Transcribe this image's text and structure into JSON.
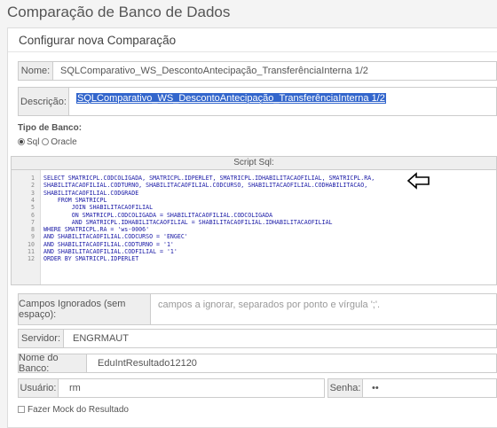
{
  "page_title": "Comparação de Banco de Dados",
  "panel_title": "Configurar nova Comparação",
  "nome": {
    "label": "Nome:",
    "value": "SQLComparativo_WS_DescontoAntecipação_TransferênciaInterna 1/2"
  },
  "descricao": {
    "label": "Descrição:",
    "value": "SQLComparativo_WS_DescontoAntecipação_TransferênciaInterna 1/2"
  },
  "tipo_banco": {
    "label": "Tipo de Banco:",
    "options": [
      {
        "label": "Sql",
        "selected": true
      },
      {
        "label": "Oracle",
        "selected": false
      }
    ]
  },
  "script": {
    "header": "Script Sql:",
    "lines": [
      {
        "n": "1",
        "text": "SELECT SMATRICPL.CODCOLIGADA, SMATRICPL.IDPERLET, SMATRICPL.IDHABILITACAOFILIAL, SMATRICPL.RA,"
      },
      {
        "n": "2",
        "text": "SHABILITACAOFILIAL.CODTURNO, SHABILITACAOFILIAL.CODCURSO, SHABILITACAOFILIAL.CODHABILITACAO,"
      },
      {
        "n": "3",
        "text": "SHABILITACAOFILIAL.CODGRADE"
      },
      {
        "n": "4",
        "text": "    FROM SMATRICPL"
      },
      {
        "n": "5",
        "text": "        JOIN SHABILITACAOFILIAL"
      },
      {
        "n": "6",
        "text": "        ON SMATRICPL.CODCOLIGADA = SHABILITACAOFILIAL.CODCOLIGADA"
      },
      {
        "n": "7",
        "text": "        AND SMATRICPL.IDHABILITACAOFILIAL = SHABILITACAOFILIAL.IDHABILITACAOFILIAL"
      },
      {
        "n": "8",
        "text": "WHERE SMATRICPL.RA = 'ws-0006'"
      },
      {
        "n": "9",
        "text": "AND SHABILITACAOFILIAL.CODCURSO = 'ENGEC'"
      },
      {
        "n": "10",
        "text": "AND SHABILITACAOFILIAL.CODTURNO = '1'"
      },
      {
        "n": "11",
        "text": "AND SHABILITACAOFILIAL.CODFILIAL = '1'"
      },
      {
        "n": "12",
        "text": "ORDER BY SMATRICPL.IDPERLET"
      }
    ]
  },
  "campos_ignorados": {
    "label": "Campos Ignorados (sem espaço):",
    "placeholder": "campos a ignorar, separados por ponto e vírgula ';'."
  },
  "servidor": {
    "label": "Servidor:",
    "value": "ENGRMAUT"
  },
  "nome_banco": {
    "label": "Nome do Banco:",
    "value": "EduIntResultado12120"
  },
  "usuario": {
    "label": "Usuário:",
    "value": "rm"
  },
  "senha": {
    "label": "Senha:",
    "value": "••"
  },
  "fazer_mock": {
    "label": "Fazer Mock do Resultado"
  },
  "icons": {
    "annotation_arrow": "left-arrow-icon"
  }
}
